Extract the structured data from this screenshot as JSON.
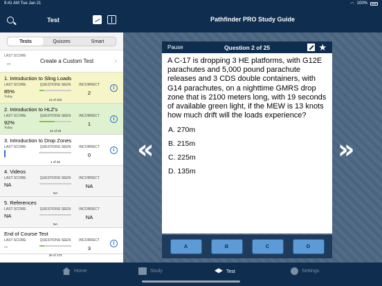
{
  "status": {
    "time": "9:41 AM",
    "date": "Tue Jan 21",
    "battery": "100%"
  },
  "sidebar": {
    "title": "Test",
    "tabs": [
      {
        "label": "Tests"
      },
      {
        "label": "Quizzes"
      },
      {
        "label": "Smart"
      }
    ],
    "create": {
      "last_score_label": "LAST SCORE",
      "last_score": "--",
      "label": "Create a Custom Test",
      "chevron": "›"
    },
    "col_labels": {
      "score": "LAST SCORE",
      "seen": "QUESTIONS SEEN",
      "incorrect": "INCORRECT"
    },
    "items": [
      {
        "name": "1. Introduction to Sling Loads",
        "score": "85%",
        "when": "Today",
        "seen": "13 of 102",
        "progress": 0.13,
        "incorrect": "2",
        "bg": "#f6f5c8",
        "info": true
      },
      {
        "name": "2. Introduction to HLZ's",
        "score": "92%",
        "when": "Today",
        "seen": "12 of 25",
        "progress": 0.48,
        "incorrect": "1",
        "bg": "#dff2d0",
        "info": true
      },
      {
        "name": "3. Introduction to Drop Zones",
        "score": "",
        "when": "",
        "seen": "1 of 46",
        "progress": 0.02,
        "incorrect": "0",
        "bg": "#ffffff",
        "info": true,
        "pending": true
      },
      {
        "name": "4. Videos",
        "score": "NA",
        "when": "",
        "seen": "NA",
        "progress": 0,
        "incorrect": "NA",
        "bg": "#f4f4f4",
        "info": false
      },
      {
        "name": "5. References",
        "score": "NA",
        "when": "",
        "seen": "NA",
        "progress": 0,
        "incorrect": "NA",
        "bg": "#f4f4f4",
        "info": false
      },
      {
        "name": "End of Course Test",
        "score": "--",
        "when": "",
        "seen": "26 of 173",
        "progress": 0.15,
        "incorrect": "3",
        "bg": "#ffffff",
        "info": true
      }
    ]
  },
  "main": {
    "title": "Pathfinder PRO Study Guide",
    "prev_arrow": "«",
    "next_arrow": "»",
    "card": {
      "pause_label": "Pause",
      "question_number": "Question 2 of 25",
      "question_text": "A C-17 is dropping 3 HE platforms, with G12E parachutes and 5,000 pound parachute releases and 3 CDS double containers, with G14 parachutes, on a nighttime GMRS drop zone that is 2100 meters long, with 19 seconds of available green light, if the MEW is 13 knots how much drift will the loads experience?",
      "answers": [
        "A. 270m",
        "B. 215m",
        "C. 225m",
        "D. 135m"
      ],
      "star": "★"
    },
    "buttons": [
      "A",
      "B",
      "C",
      "D"
    ]
  },
  "tabbar": {
    "tabs": [
      {
        "label": "Home",
        "icon": "home-icon"
      },
      {
        "label": "Study",
        "icon": "study-icon"
      },
      {
        "label": "Test",
        "icon": "test-icon",
        "active": true
      },
      {
        "label": "Settings",
        "icon": "settings-icon"
      }
    ]
  }
}
